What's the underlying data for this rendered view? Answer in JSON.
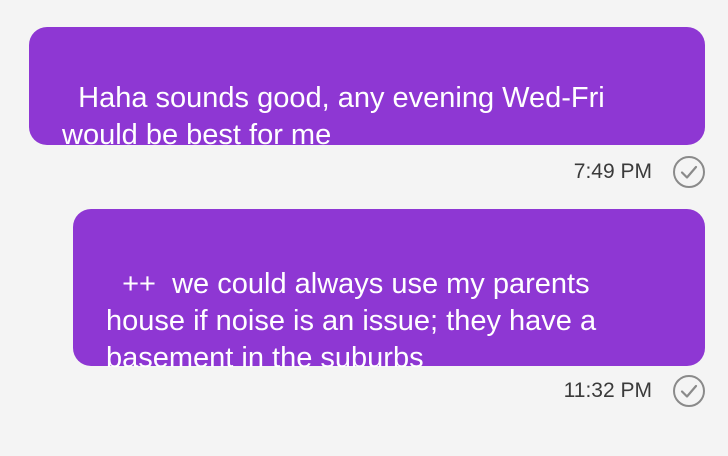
{
  "messages": [
    {
      "text": "Haha sounds good, any evening Wed-Fri\nwould be best for me",
      "time": "7:49 PM",
      "status_icon": "checkmark-circle-icon"
    },
    {
      "text": "++  we could always use my parents\nhouse if noise is an issue; they have a\nbasement in the suburbs",
      "time": "11:32 PM",
      "status_icon": "checkmark-circle-icon"
    }
  ],
  "colors": {
    "bubble": "#8e37d3",
    "bubble_text": "#ffffff",
    "background": "#f4f4f4",
    "timestamp": "#3a3a3a",
    "check": "#8a8a8a"
  }
}
